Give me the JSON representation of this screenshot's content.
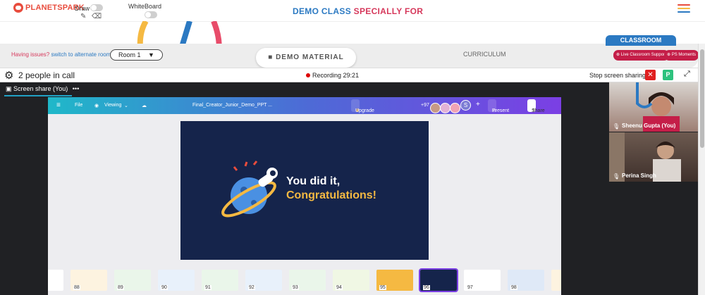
{
  "header": {
    "logo": "PLANETSPARK",
    "draw_label": "Draw",
    "whiteboard_label": "WhiteBoard",
    "title_part1": "DEMO CLASS",
    "title_part2": "SPECIALLY FOR",
    "colors": {
      "blue": "#2b79c2",
      "red": "#d6385b"
    }
  },
  "toolbar": {
    "issue_text": "Having issues?",
    "issue_link": "switch to alternate room",
    "room_select": "Room 1",
    "demo_material": "DEMO MATERIAL",
    "curriculum": "CURRICULUM",
    "classroom_tab": "CLASSROOM",
    "live_support": "Live Classroom Support",
    "ps_moments": "PS Moments"
  },
  "call": {
    "people": "2 people in call",
    "recording_label": "Recording",
    "recording_time": "29:21",
    "stop_sharing": "Stop screen sharing",
    "p_badge": "P"
  },
  "share": {
    "label": "Screen share (You)",
    "more": "•••"
  },
  "canva": {
    "file": "File",
    "viewing": "Viewing",
    "doc_title": "Final_Creator_Junior_Demo_PPT ...",
    "upgrade": "Upgrade to Canva Pro",
    "collab_count": "+97",
    "avatar_letter": "S",
    "present": "Present",
    "share": "Share",
    "slide_line1": "You did it,",
    "slide_line2": "Congratulations!",
    "thumbs": [
      "88",
      "89",
      "90",
      "91",
      "92",
      "93",
      "94",
      "95",
      "96",
      "97",
      "98"
    ]
  },
  "participants": [
    {
      "name": "Sheenu Gupta (You)"
    },
    {
      "name": "Perina Singh"
    }
  ]
}
